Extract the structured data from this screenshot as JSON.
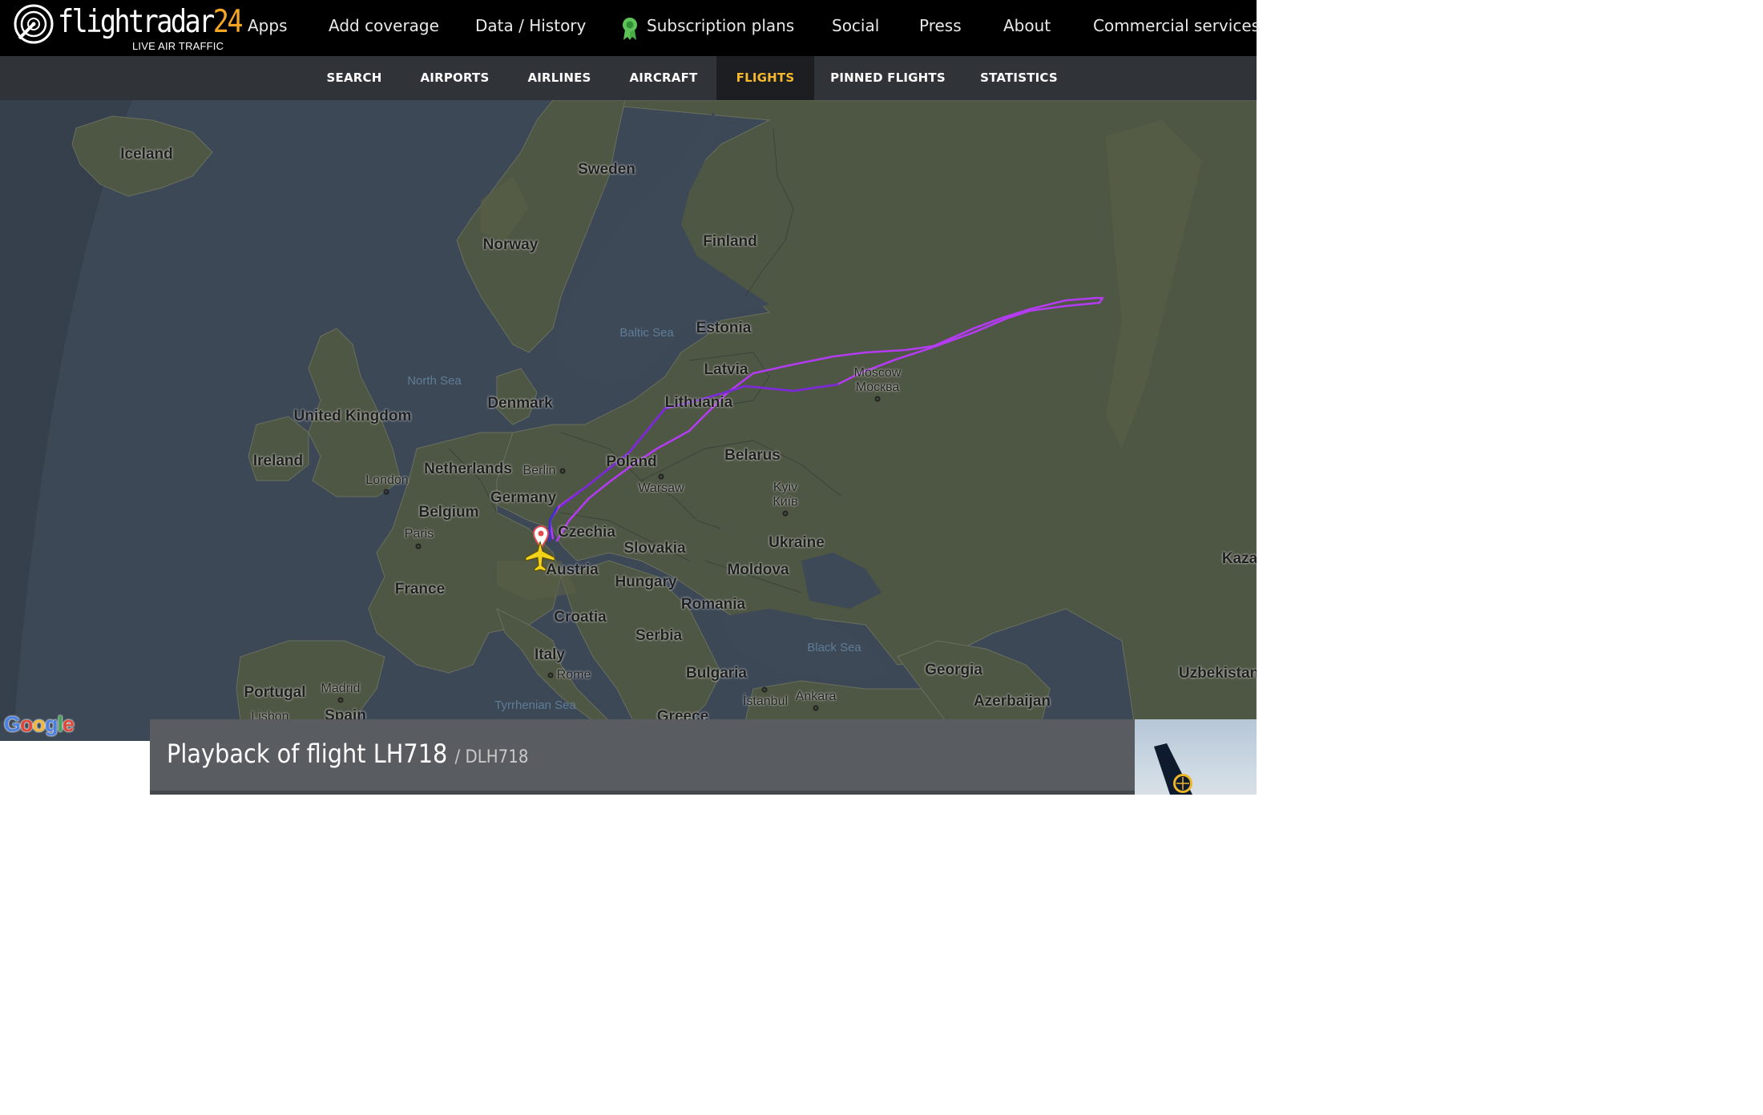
{
  "header": {
    "logo_text": "flightradar",
    "logo_number": "24",
    "logo_tagline": "LIVE AIR TRAFFIC",
    "nav": [
      "Apps",
      "Add coverage",
      "Data / History",
      "Subscription plans",
      "Social",
      "Press",
      "About",
      "Commercial services"
    ]
  },
  "subnav": {
    "items": [
      "SEARCH",
      "AIRPORTS",
      "AIRLINES",
      "AIRCRAFT",
      "FLIGHTS",
      "PINNED FLIGHTS",
      "STATISTICS"
    ],
    "active": "FLIGHTS"
  },
  "map": {
    "countries": {
      "iceland": "Iceland",
      "sweden": "Sweden",
      "norway": "Norway",
      "finland": "Finland",
      "estonia": "Estonia",
      "latvia": "Latvia",
      "lithuania": "Lithuania",
      "denmark": "Denmark",
      "united_kingdom": "United Kingdom",
      "ireland": "Ireland",
      "netherlands": "Netherlands",
      "belgium": "Belgium",
      "germany": "Germany",
      "poland": "Poland",
      "belarus": "Belarus",
      "czechia": "Czechia",
      "slovakia": "Slovakia",
      "austria": "Austria",
      "hungary": "Hungary",
      "moldova": "Moldova",
      "ukraine": "Ukraine",
      "france": "France",
      "croatia": "Croatia",
      "romania": "Romania",
      "serbia": "Serbia",
      "italy": "Italy",
      "bulgaria": "Bulgaria",
      "portugal": "Portugal",
      "spain": "Spain",
      "greece": "Greece",
      "georgia": "Georgia",
      "azerbaijan": "Azerbaijan",
      "uzbekistan": "Uzbekistan",
      "kazakhstan": "Kaza"
    },
    "cities": {
      "london": "London",
      "paris": "Paris",
      "berlin": "Berlin",
      "warsaw": "Warsaw",
      "kyiv": "Kyiv",
      "kyiv_local": "Київ",
      "moscow": "Moscow",
      "moscow_local": "Москва",
      "rome": "Rome",
      "madrid": "Madrid",
      "lisbon": "Lisbon",
      "istanbul": "İstanbul",
      "ankara": "Ankara"
    },
    "seas": {
      "north_sea": "North Sea",
      "baltic_sea": "Baltic Sea",
      "black_sea": "Black Sea",
      "tyrrhenian_sea": "Tyrrhenian Sea"
    },
    "attribution": "Google",
    "colors": {
      "track_primary": "#b33cf0",
      "track_secondary": "#7b28d8",
      "track_start": "#3b2fd0",
      "aircraft": "#f2d21a",
      "pin": "#e64a4a"
    }
  },
  "playback": {
    "title": "Playback of flight LH718",
    "callsign": "/ DLH718"
  }
}
